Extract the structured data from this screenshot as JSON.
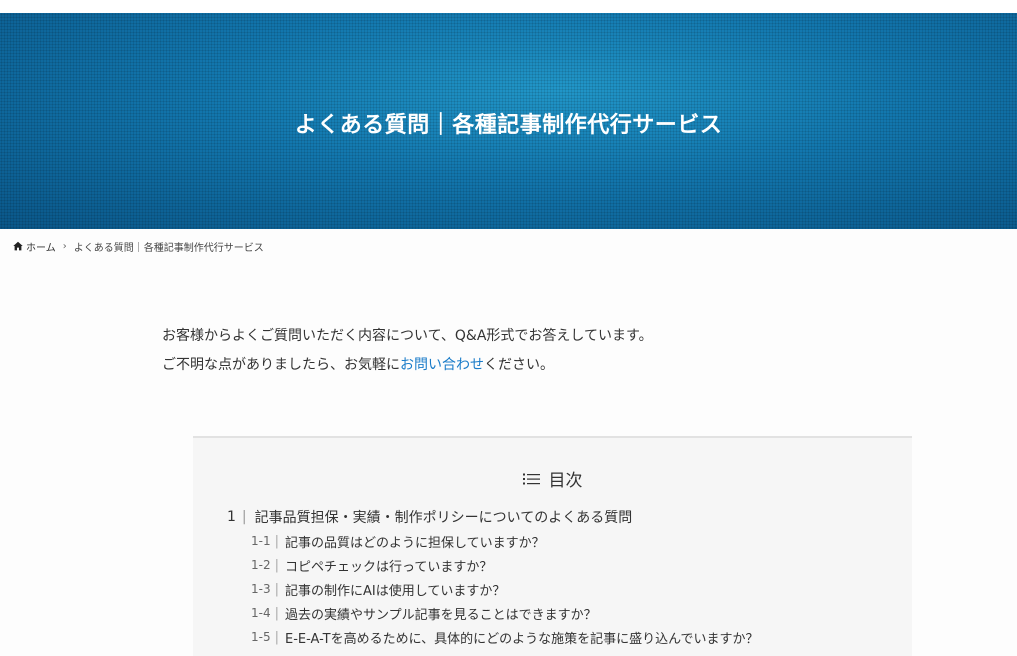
{
  "hero": {
    "title": "よくある質問｜各種記事制作代行サービス"
  },
  "breadcrumb": {
    "home": "ホーム",
    "current": "よくある質問｜各種記事制作代行サービス"
  },
  "intro": {
    "line1": "お客様からよくご質問いただく内容について、Q&A形式でお答えしています。",
    "line2_pre": "ご不明な点がありましたら、お気軽に",
    "line2_link": "お問い合わせ",
    "line2_post": "ください。"
  },
  "toc": {
    "title": "目次",
    "sections": [
      {
        "num": "1",
        "label": "記事品質担保・実績・制作ポリシーについてのよくある質問",
        "items": [
          {
            "num": "1-1",
            "label": "記事の品質はどのように担保していますか？"
          },
          {
            "num": "1-2",
            "label": "コピペチェックは行っていますか？"
          },
          {
            "num": "1-3",
            "label": "記事の制作にAIは使用していますか？"
          },
          {
            "num": "1-4",
            "label": "過去の実績やサンプル記事を見ることはできますか？"
          },
          {
            "num": "1-5",
            "label": "E-E-A-Tを高めるために、具体的にどのような施策を記事に盛り込んでいますか？"
          }
        ]
      }
    ]
  },
  "colors": {
    "link": "#1a7cc9",
    "hero_dark": "#0a5688",
    "hero_light": "#2196c8"
  }
}
